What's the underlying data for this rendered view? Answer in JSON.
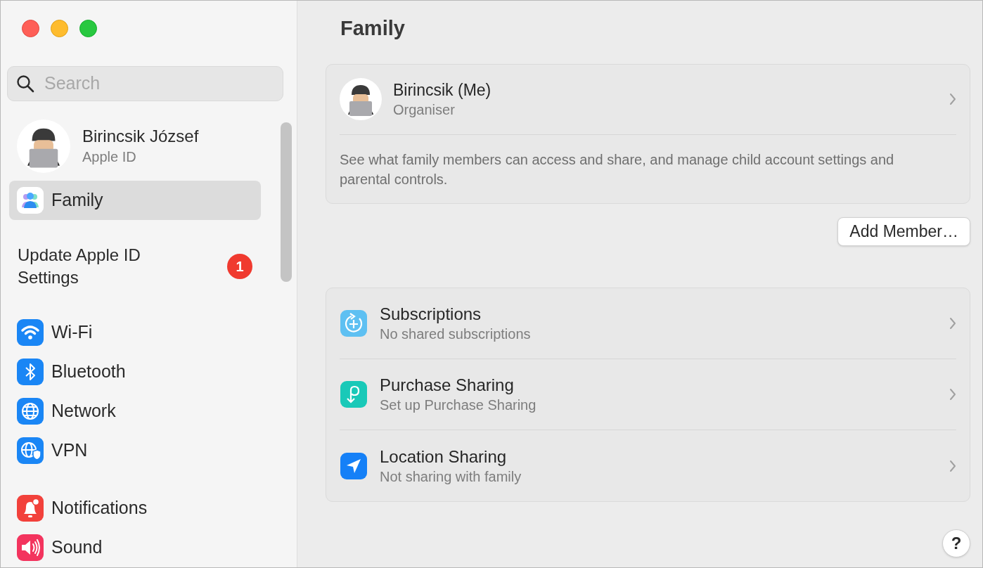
{
  "sidebar": {
    "search": {
      "placeholder": "Search"
    },
    "profile": {
      "name": "Birincsik József",
      "subtitle": "Apple ID"
    },
    "items": [
      {
        "kind": "nav",
        "label": "Family",
        "selected": true
      },
      {
        "kind": "alert",
        "label": "Update Apple ID Settings",
        "badge": "1",
        "selected": false
      },
      {
        "kind": "nav",
        "label": "Wi-Fi",
        "selected": false
      },
      {
        "kind": "nav",
        "label": "Bluetooth",
        "selected": false
      },
      {
        "kind": "nav",
        "label": "Network",
        "selected": false
      },
      {
        "kind": "nav",
        "label": "VPN",
        "selected": false
      },
      {
        "kind": "gap"
      },
      {
        "kind": "nav",
        "label": "Notifications",
        "selected": false
      },
      {
        "kind": "nav",
        "label": "Sound",
        "selected": false
      }
    ]
  },
  "main": {
    "title": "Family",
    "member": {
      "name": "Birincsik (Me)",
      "role": "Organiser"
    },
    "description": "See what family members can access and share, and manage child account settings and parental controls.",
    "add_button": "Add Member…",
    "features": [
      {
        "title": "Subscriptions",
        "subtitle": "No shared subscriptions"
      },
      {
        "title": "Purchase Sharing",
        "subtitle": "Set up Purchase Sharing"
      },
      {
        "title": "Location Sharing",
        "subtitle": "Not sharing with family"
      }
    ],
    "help_button": "?"
  }
}
